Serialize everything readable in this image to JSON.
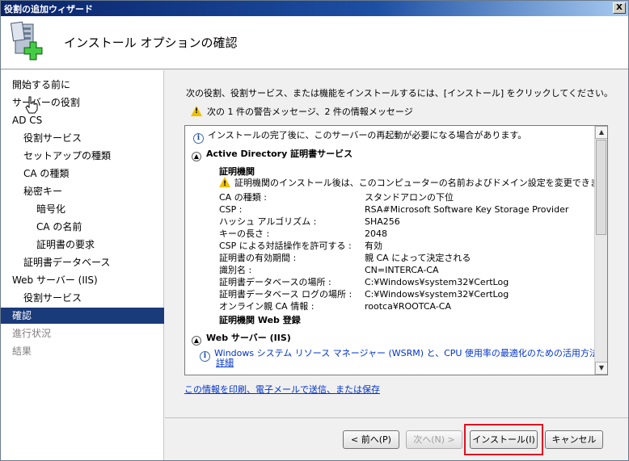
{
  "window": {
    "title": "役割の追加ウィザード",
    "close_label": "X"
  },
  "header": {
    "title": "インストール オプションの確認",
    "icon": "server-add-icon"
  },
  "nav": {
    "items": [
      {
        "label": "開始する前に",
        "level": 0,
        "state": "normal"
      },
      {
        "label": "サーバーの役割",
        "level": 0,
        "state": "normal"
      },
      {
        "label": "AD CS",
        "level": 0,
        "state": "normal"
      },
      {
        "label": "役割サービス",
        "level": 1,
        "state": "normal"
      },
      {
        "label": "セットアップの種類",
        "level": 1,
        "state": "normal"
      },
      {
        "label": "CA の種類",
        "level": 1,
        "state": "normal"
      },
      {
        "label": "秘密キー",
        "level": 1,
        "state": "normal"
      },
      {
        "label": "暗号化",
        "level": 2,
        "state": "normal"
      },
      {
        "label": "CA の名前",
        "level": 2,
        "state": "normal"
      },
      {
        "label": "証明書の要求",
        "level": 2,
        "state": "normal"
      },
      {
        "label": "証明書データベース",
        "level": 1,
        "state": "normal"
      },
      {
        "label": "Web サーバー (IIS)",
        "level": 0,
        "state": "normal"
      },
      {
        "label": "役割サービス",
        "level": 1,
        "state": "normal"
      },
      {
        "label": "確認",
        "level": 0,
        "state": "selected"
      },
      {
        "label": "進行状況",
        "level": 0,
        "state": "disabled"
      },
      {
        "label": "結果",
        "level": 0,
        "state": "disabled"
      }
    ]
  },
  "main": {
    "instruction": "次の役割、役割サービス、または機能をインストールするには、[インストール] をクリックしてください。",
    "warning_summary": "次の 1 件の警告メッセージ、2 件の情報メッセージ",
    "info_restart": "インストールの完了後に、このサーバーの再起動が必要になる場合があります。",
    "section_adcs": "Active Directory 証明書サービス",
    "sub_ca": "証明機関",
    "ca_warning": "証明機関のインストール後は、このコンピューターの名前およびドメイン設定を変更できません。",
    "properties": [
      {
        "label": "CA の種類 :",
        "value": "スタンドアロンの下位"
      },
      {
        "label": "CSP :",
        "value": "RSA#Microsoft Software Key Storage Provider"
      },
      {
        "label": "ハッシュ アルゴリズム :",
        "value": "SHA256"
      },
      {
        "label": "キーの長さ :",
        "value": "2048"
      },
      {
        "label": "CSP による対話操作を許可する :",
        "value": "有効"
      },
      {
        "label": "証明書の有効期間 :",
        "value": "親 CA によって決定される"
      },
      {
        "label": "識別名 :",
        "value": "CN=INTERCA-CA"
      },
      {
        "label": "証明書データベースの場所 :",
        "value": "C:¥Windows¥system32¥CertLog"
      },
      {
        "label": "証明書データベース ログの場所 :",
        "value": "C:¥Windows¥system32¥CertLog"
      },
      {
        "label": "オンライン親 CA 情報 :",
        "value": "rootca¥ROOTCA-CA"
      }
    ],
    "sub_web_enroll": "証明機関 Web 登録",
    "section_iis": "Web サーバー (IIS)",
    "iis_info_line1": "Windows システム リソース マネージャー (WSRM) と、CPU 使用率の最適化のための活用方法の",
    "iis_info_line2": "詳細",
    "print_link": "この情報を印刷、電子メールで送信、または保存"
  },
  "footer": {
    "back_label": "< 前へ(P)",
    "next_label": "次へ(N) >",
    "install_label": "インストール(I)",
    "cancel_label": "キャンセル"
  },
  "colors": {
    "selected_nav": "#1a3a7a",
    "highlight": "#e01020",
    "link": "#0033cc"
  }
}
